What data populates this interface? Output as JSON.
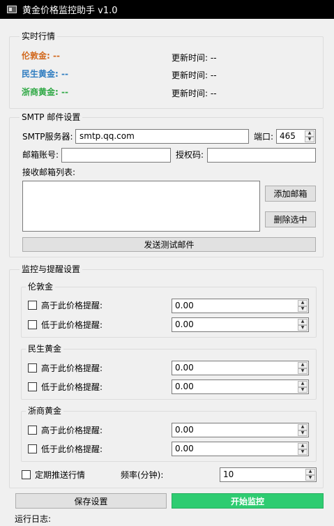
{
  "window": {
    "title": "黄金价格监控助手 v1.0"
  },
  "realtime": {
    "title": "实时行情",
    "items": [
      {
        "label": "伦敦金: --",
        "color": "#d2691e",
        "update_label": "更新时间: --"
      },
      {
        "label": "民生黄金: --",
        "color": "#2e7cc0",
        "update_label": "更新时间: --"
      },
      {
        "label": "浙商黄金: --",
        "color": "#2ea844",
        "update_label": "更新时间: --"
      }
    ]
  },
  "smtp": {
    "title": "SMTP 邮件设置",
    "server_label": "SMTP服务器:",
    "server_value": "smtp.qq.com",
    "port_label": "端口:",
    "port_value": "465",
    "account_label": "邮箱账号:",
    "account_value": "",
    "auth_label": "授权码:",
    "auth_value": "",
    "recipients_label": "接收邮箱列表:",
    "add_button": "添加邮箱",
    "remove_button": "删除选中",
    "test_button": "发送测试邮件"
  },
  "monitor": {
    "title": "监控与提醒设置",
    "groups": [
      {
        "title": "伦敦金",
        "high_label": "高于此价格提醒:",
        "high_value": "0.00",
        "low_label": "低于此价格提醒:",
        "low_value": "0.00"
      },
      {
        "title": "民生黄金",
        "high_label": "高于此价格提醒:",
        "high_value": "0.00",
        "low_label": "低于此价格提醒:",
        "low_value": "0.00"
      },
      {
        "title": "浙商黄金",
        "high_label": "高于此价格提醒:",
        "high_value": "0.00",
        "low_label": "低于此价格提醒:",
        "low_value": "0.00"
      }
    ],
    "periodic_label": "定期推送行情",
    "freq_label": "频率(分钟):",
    "freq_value": "10"
  },
  "actions": {
    "save_button": "保存设置",
    "start_button": "开始监控",
    "start_color": "#2ecc71"
  },
  "log": {
    "label": "运行日志:"
  }
}
